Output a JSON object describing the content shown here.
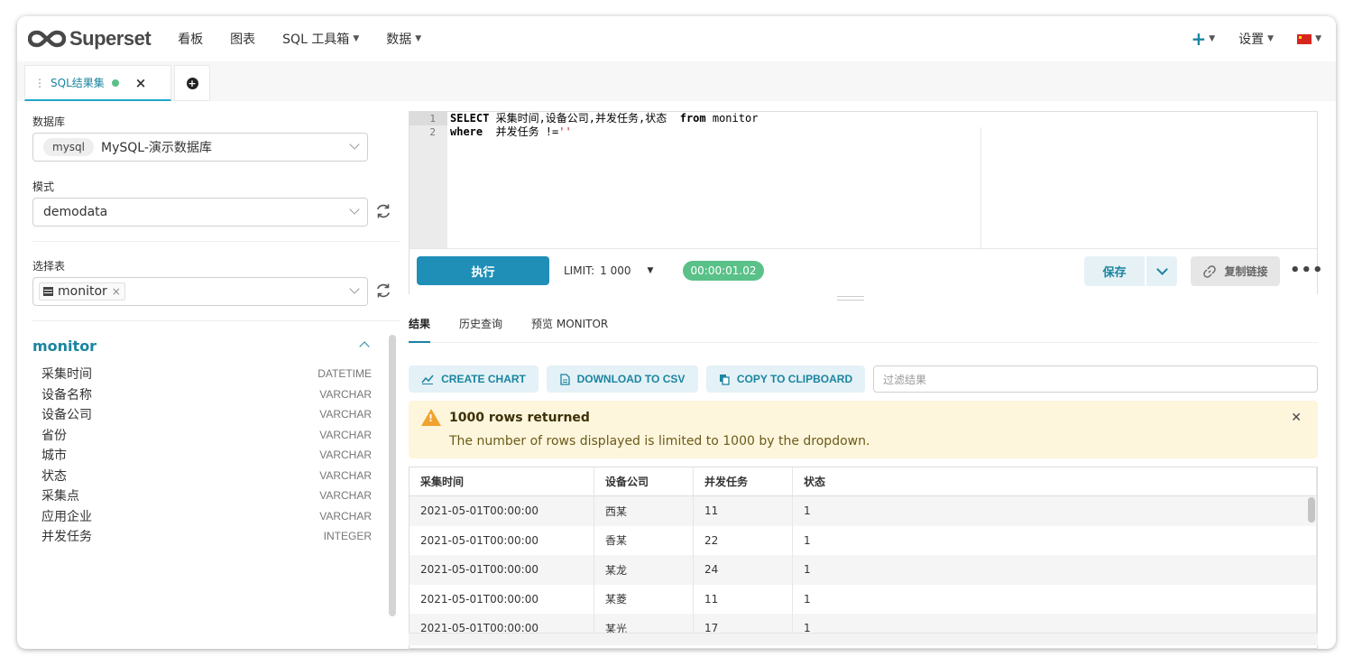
{
  "navbar": {
    "brand": "Superset",
    "menu": [
      {
        "label": "看板",
        "dropdown": false
      },
      {
        "label": "图表",
        "dropdown": false
      },
      {
        "label": "SQL 工具箱",
        "dropdown": true
      },
      {
        "label": "数据",
        "dropdown": true
      }
    ],
    "settings_label": "设置",
    "add_icon": "plus-icon",
    "language_icon": "china-flag-icon"
  },
  "tabs": {
    "query_tab_label": "SQL结果集",
    "status_color": "#5ac189",
    "add_icon": "add-circle-icon"
  },
  "left_panel": {
    "database_label": "数据库",
    "database_badge": "mysql",
    "database_value": "MySQL-演示数据库",
    "schema_label": "模式",
    "schema_value": "demodata",
    "table_label": "选择表",
    "table_value": "monitor",
    "table_name": "monitor",
    "columns": [
      {
        "name": "采集时间",
        "type": "DATETIME"
      },
      {
        "name": "设备名称",
        "type": "VARCHAR"
      },
      {
        "name": "设备公司",
        "type": "VARCHAR"
      },
      {
        "name": "省份",
        "type": "VARCHAR"
      },
      {
        "name": "城市",
        "type": "VARCHAR"
      },
      {
        "name": "状态",
        "type": "VARCHAR"
      },
      {
        "name": "采集点",
        "type": "VARCHAR"
      },
      {
        "name": "应用企业",
        "type": "VARCHAR"
      },
      {
        "name": "并发任务",
        "type": "INTEGER"
      }
    ]
  },
  "editor": {
    "line_numbers": [
      "1",
      "2"
    ],
    "line1_kw1": "SELECT",
    "line1_cols": " 采集时间,设备公司,并发任务,状态  ",
    "line1_kw2": "from",
    "line1_table": " monitor",
    "line2_kw": "where",
    "line2_cond": "  并发任务 !=",
    "line2_str": "''",
    "run_label": "执行",
    "limit_label": "LIMIT:",
    "limit_value": "1 000",
    "timer": "00:00:01.02",
    "save_label": "保存",
    "copy_link_label": "复制链接",
    "more_label": "•••"
  },
  "results": {
    "tabs": [
      "结果",
      "历史查询",
      "预览 MONITOR"
    ],
    "active_tab": "结果",
    "create_chart_label": "CREATE CHART",
    "download_csv_label": "DOWNLOAD TO CSV",
    "copy_clipboard_label": "COPY TO CLIPBOARD",
    "filter_placeholder": "过滤结果",
    "warning_title": "1000 rows returned",
    "warning_message": "The number of rows displayed is limited to 1000 by the dropdown.",
    "columns": [
      "采集时间",
      "设备公司",
      "并发任务",
      "状态"
    ],
    "rows": [
      [
        "2021-05-01T00:00:00",
        "西某",
        "11",
        "1"
      ],
      [
        "2021-05-01T00:00:00",
        "香某",
        "22",
        "1"
      ],
      [
        "2021-05-01T00:00:00",
        "某龙",
        "24",
        "1"
      ],
      [
        "2021-05-01T00:00:00",
        "某菱",
        "11",
        "1"
      ],
      [
        "2021-05-01T00:00:00",
        "某光",
        "17",
        "1"
      ]
    ]
  }
}
